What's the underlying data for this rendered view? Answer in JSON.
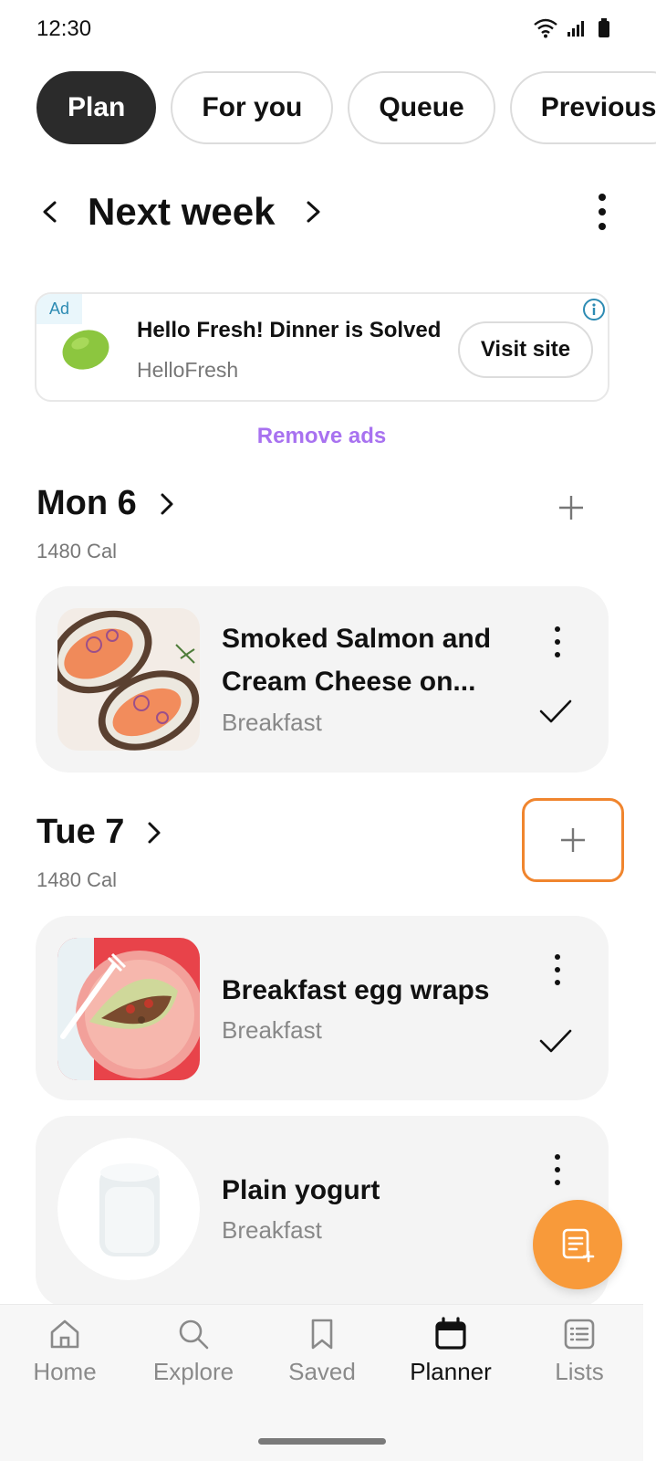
{
  "status_bar": {
    "time": "12:30"
  },
  "tabs": [
    {
      "label": "Plan",
      "active": true
    },
    {
      "label": "For you",
      "active": false
    },
    {
      "label": "Queue",
      "active": false
    },
    {
      "label": "Previous",
      "active": false
    }
  ],
  "week": {
    "title": "Next week"
  },
  "ad": {
    "tag": "Ad",
    "title": "Hello Fresh! Dinner is Solved",
    "advertiser": "HelloFresh",
    "button_label": "Visit site"
  },
  "remove_ads": "Remove ads",
  "days": [
    {
      "title": "Mon 6",
      "calories": "1480 Cal",
      "meals": [
        {
          "name": "Smoked Salmon and Cream Cheese on...",
          "type": "Breakfast",
          "checked": true
        }
      ]
    },
    {
      "title": "Tue 7",
      "calories": "1480 Cal",
      "meals": [
        {
          "name": "Breakfast egg wraps",
          "type": "Breakfast",
          "checked": true
        },
        {
          "name": "Plain yogurt",
          "type": "Breakfast",
          "checked": false
        }
      ]
    }
  ],
  "bottom_nav": [
    {
      "label": "Home",
      "icon": "home-icon",
      "active": false
    },
    {
      "label": "Explore",
      "icon": "search-icon",
      "active": false
    },
    {
      "label": "Saved",
      "icon": "bookmark-icon",
      "active": false
    },
    {
      "label": "Planner",
      "icon": "calendar-icon",
      "active": true
    },
    {
      "label": "Lists",
      "icon": "list-icon",
      "active": false
    }
  ],
  "colors": {
    "accent_orange": "#f89a3a",
    "focus_outline": "#f0852e",
    "remove_ads_purple": "#a872f0",
    "active_tab": "#2b2b2b"
  }
}
